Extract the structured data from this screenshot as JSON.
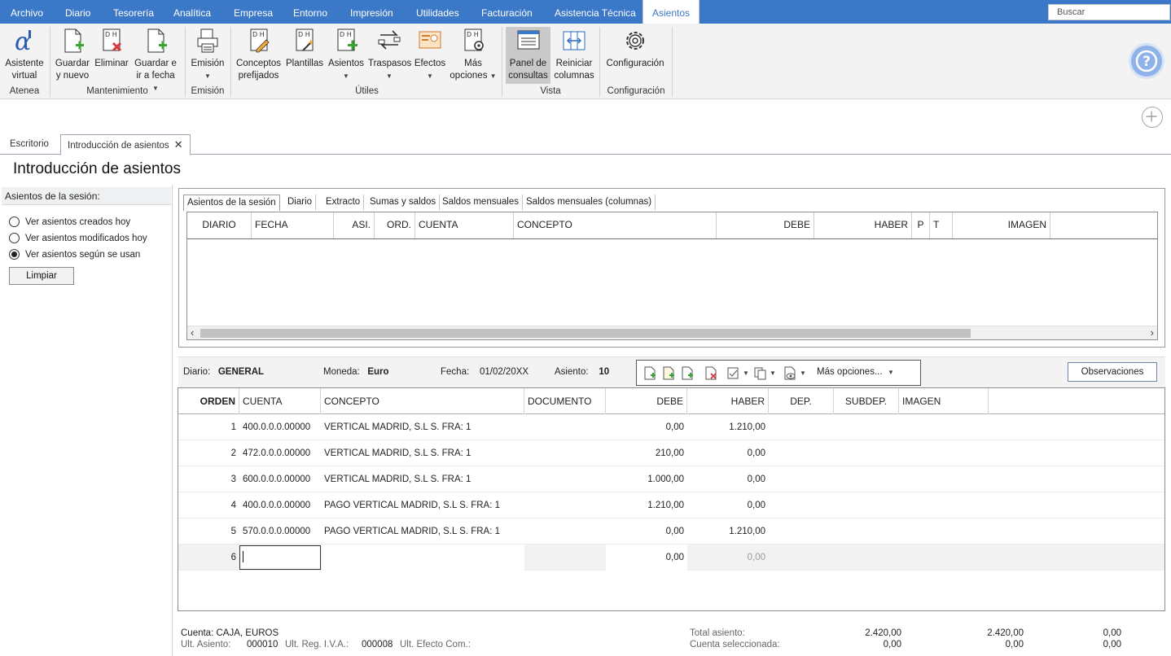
{
  "menu": {
    "tabs": [
      "Archivo",
      "Diario",
      "Tesorería",
      "Analítica",
      "Empresa",
      "Entorno",
      "Impresión",
      "Utilidades",
      "Facturación",
      "Asistencia Técnica",
      "Asientos"
    ],
    "active": "Asientos",
    "search_placeholder": "Buscar"
  },
  "ribbon": {
    "buttons": {
      "asistente": [
        "Asistente",
        "virtual"
      ],
      "guardar_nuevo": [
        "Guardar",
        "y nuevo"
      ],
      "eliminar": [
        "Eliminar",
        ""
      ],
      "guardar_fecha": [
        "Guardar e",
        "ir a fecha"
      ],
      "emision": [
        "Emisión",
        ""
      ],
      "conceptos": [
        "Conceptos",
        "prefijados"
      ],
      "plantillas": [
        "Plantillas",
        ""
      ],
      "asientos": [
        "Asientos",
        ""
      ],
      "traspasos": [
        "Traspasos",
        ""
      ],
      "efectos": [
        "Efectos",
        ""
      ],
      "mas_opciones": [
        "Más",
        "opciones"
      ],
      "panel": [
        "Panel de",
        "consultas"
      ],
      "reiniciar": [
        "Reiniciar",
        "columnas"
      ],
      "configuracion": [
        "Configuración",
        ""
      ]
    },
    "groups": {
      "atenea": "Atenea",
      "mantenimiento": "Mantenimiento",
      "emision": "Emisión",
      "utiles": "Útiles",
      "vista": "Vista",
      "configuracion": "Configuración"
    }
  },
  "doctabs": {
    "escritorio": "Escritorio",
    "introduccion": "Introducción de asientos"
  },
  "page_title": "Introducción de asientos",
  "left_panel": {
    "header": "Asientos de la sesión:",
    "options": [
      "Ver asientos creados hoy",
      "Ver asientos modificados hoy",
      "Ver asientos según se usan"
    ],
    "selected_index": 2,
    "clear_label": "Limpiar"
  },
  "query_panel": {
    "tabs": [
      "Asientos de la sesión",
      "Diario",
      "Extracto",
      "Sumas y saldos",
      "Saldos mensuales",
      "Saldos mensuales (columnas)"
    ],
    "columns": [
      "DIARIO",
      "FECHA",
      "ASI.",
      "ORD.",
      "CUENTA",
      "CONCEPTO",
      "DEBE",
      "HABER",
      "P",
      "T",
      "IMAGEN"
    ]
  },
  "info": {
    "diario_label": "Diario:",
    "diario_value": "GENERAL",
    "moneda_label": "Moneda:",
    "moneda_value": "Euro",
    "fecha_label": "Fecha:",
    "fecha_value": "01/02/20XX",
    "asiento_label": "Asiento:",
    "asiento_value": "10",
    "mas_opciones": "Más opciones...",
    "observaciones": "Observaciones"
  },
  "entries": {
    "columns": [
      "ORDEN",
      "CUENTA",
      "CONCEPTO",
      "DOCUMENTO",
      "DEBE",
      "HABER",
      "DEP.",
      "SUBDEP.",
      "IMAGEN"
    ],
    "rows": [
      {
        "orden": "1",
        "cuenta": "400.0.0.0.00000",
        "concepto": "VERTICAL MADRID, S.L S. FRA:  1",
        "debe": "0,00",
        "haber": "1.210,00"
      },
      {
        "orden": "2",
        "cuenta": "472.0.0.0.00000",
        "concepto": "VERTICAL MADRID, S.L S. FRA:  1",
        "debe": "210,00",
        "haber": "0,00"
      },
      {
        "orden": "3",
        "cuenta": "600.0.0.0.00000",
        "concepto": "VERTICAL MADRID, S.L S. FRA:  1",
        "debe": "1.000,00",
        "haber": "0,00"
      },
      {
        "orden": "4",
        "cuenta": "400.0.0.0.00000",
        "concepto": "PAGO VERTICAL MADRID, S.L S. FRA:  1",
        "debe": "1.210,00",
        "haber": "0,00"
      },
      {
        "orden": "5",
        "cuenta": "570.0.0.0.00000",
        "concepto": "PAGO VERTICAL MADRID, S.L S. FRA:  1",
        "debe": "0,00",
        "haber": "1.210,00"
      }
    ],
    "edit_row": {
      "orden": "6",
      "debe": "0,00",
      "haber": "0,00"
    }
  },
  "footer": {
    "cuenta_label": "Cuenta:",
    "cuenta_value": "CAJA, EUROS",
    "ult_asiento_label": "Ult. Asiento:",
    "ult_asiento_value": "000010",
    "ult_iva_label": "Ult. Reg. I.V.A.:",
    "ult_iva_value": "000008",
    "ult_efecto_label": "Ult. Efecto Com.:",
    "total_label": "Total asiento:",
    "total_debe": "2.420,00",
    "total_haber": "2.420,00",
    "total_saldo": "0,00",
    "sel_label": "Cuenta seleccionada:",
    "sel_debe": "0,00",
    "sel_haber": "0,00",
    "sel_saldo": "0,00"
  },
  "colors": {
    "menubar": "#3c78c8",
    "accent_green": "#3aa335",
    "accent_red": "#d63a3a",
    "help": "#8fb3e8"
  }
}
